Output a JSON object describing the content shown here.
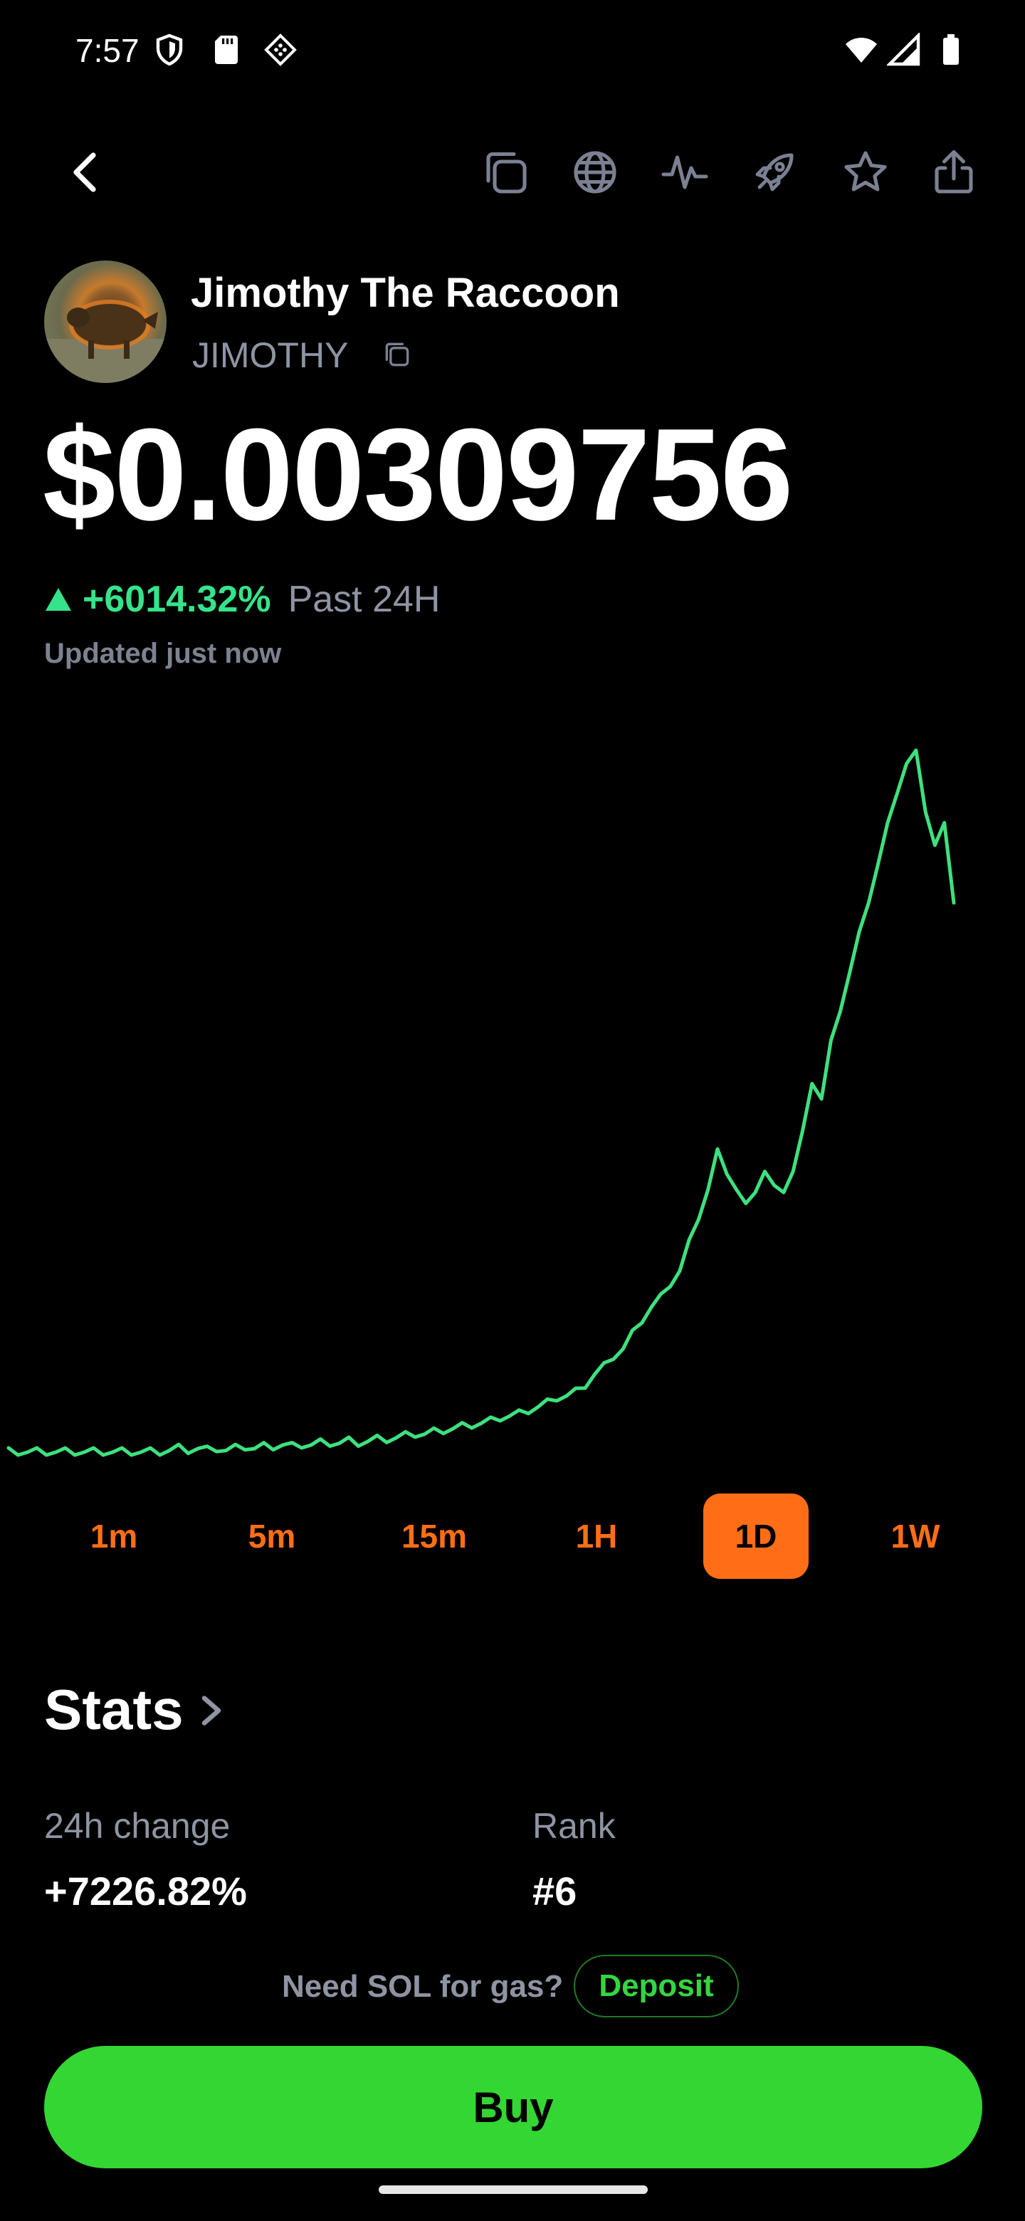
{
  "status_bar": {
    "time": "7:57",
    "icons": [
      "shield-icon",
      "sd-card-icon",
      "app-icon",
      "wifi-icon",
      "signal-icon",
      "battery-icon"
    ]
  },
  "toolbar": {
    "back": "back-arrow-icon",
    "actions": [
      "copy-icon",
      "globe-icon",
      "activity-icon",
      "rocket-icon",
      "star-icon",
      "share-icon"
    ]
  },
  "token": {
    "name": "Jimothy The Raccoon",
    "ticker": "JIMOTHY",
    "price": "$0.00309756",
    "change_pct": "+6014.32%",
    "change_period": "Past 24H",
    "updated": "Updated just now"
  },
  "colors": {
    "accent_green": "#35e48a",
    "chart_line": "#3ee07f",
    "range_orange": "#ff6e16",
    "buy_green": "#34d633",
    "muted": "#8f94a3"
  },
  "chart_data": {
    "type": "line",
    "title": "",
    "xlabel": "",
    "ylabel": "",
    "grid": false,
    "x": [
      0,
      1,
      2,
      3,
      4,
      5,
      6,
      7,
      8,
      9,
      10,
      11,
      12,
      13,
      14,
      15,
      16,
      17,
      18,
      19,
      20,
      21,
      22,
      23,
      24,
      25,
      26,
      27,
      28,
      29,
      30,
      31,
      32,
      33,
      34,
      35,
      36,
      37,
      38,
      39,
      40,
      41,
      42,
      43,
      44,
      45,
      46,
      47,
      48,
      49,
      50,
      51,
      52,
      53,
      54,
      55,
      56,
      57,
      58,
      59,
      60,
      61,
      62,
      63,
      64,
      65,
      66,
      67,
      68,
      69,
      70,
      71,
      72,
      73,
      74,
      75,
      76,
      77,
      78,
      79,
      80,
      81,
      82,
      83,
      84,
      85,
      86,
      87,
      88,
      89,
      90,
      91,
      92,
      93,
      94,
      95,
      96,
      97,
      98,
      99,
      100
    ],
    "series": [
      {
        "values": [
          5.09e-05,
          5.09e-05,
          5.09e-05,
          5.09e-05,
          5.09e-05,
          5.09e-05,
          5.09e-05,
          5.09e-05,
          5.09e-05,
          5.09e-05,
          5.09e-05,
          5.09e-05,
          5.09e-05,
          5.09e-05,
          5.09e-05,
          5.09e-05,
          5.09e-05,
          6e-05,
          7e-05,
          6e-05,
          7e-05,
          6e-05,
          7e-05,
          6e-05,
          7e-05,
          8e-05,
          7e-05,
          8e-05,
          8e-05,
          9e-05,
          8e-05,
          9e-05,
          9e-05,
          0.0001,
          0.0001,
          0.0001,
          0.00011,
          0.0001,
          0.00011,
          0.00012,
          0.00012,
          0.00013,
          0.00014,
          0.00015,
          0.00015,
          0.00016,
          0.00017,
          0.00018,
          0.00019,
          0.0002,
          0.00021,
          0.00022,
          0.00024,
          0.00025,
          0.00026,
          0.00028,
          0.0003,
          0.00032,
          0.00035,
          0.00036,
          0.00038,
          0.00042,
          0.00048,
          0.00052,
          0.00058,
          0.00062,
          0.0007,
          0.00078,
          0.00085,
          0.0009,
          0.00098,
          0.00105,
          0.0012,
          0.00135,
          0.0015,
          0.0017,
          0.0016,
          0.0015,
          0.0014,
          0.0015,
          0.0016,
          0.0015,
          0.0015,
          0.0016,
          0.0018,
          0.0021,
          0.002,
          0.0023,
          0.0025,
          0.0027,
          0.0029,
          0.0031,
          0.0033,
          0.0035,
          0.0037,
          0.00385,
          0.0039,
          0.0036,
          0.0034,
          0.0035,
          0.00309756
        ]
      }
    ]
  },
  "ranges": [
    {
      "label": "1m",
      "active": false
    },
    {
      "label": "5m",
      "active": false
    },
    {
      "label": "15m",
      "active": false
    },
    {
      "label": "1H",
      "active": false
    },
    {
      "label": "1D",
      "active": true
    },
    {
      "label": "1W",
      "active": false
    }
  ],
  "stats": {
    "title": "Stats",
    "change_label": "24h change",
    "change_value": "+7226.82%",
    "rank_label": "Rank",
    "rank_value": "#6"
  },
  "gas": {
    "text": "Need SOL for gas?",
    "deposit": "Deposit"
  },
  "buy": {
    "label": "Buy"
  }
}
